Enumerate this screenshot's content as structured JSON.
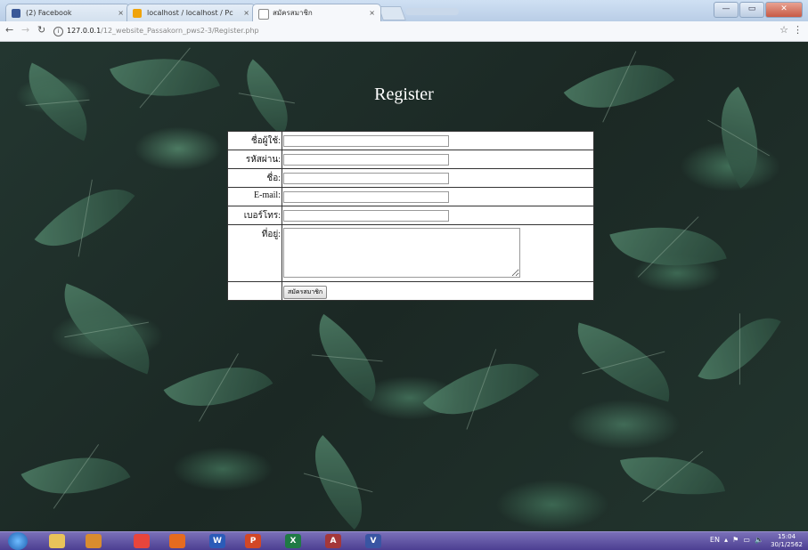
{
  "browser": {
    "tabs": [
      {
        "label": "(2) Facebook",
        "icon": "facebook-icon",
        "color": "#3b5998"
      },
      {
        "label": "localhost / localhost / Pc",
        "icon": "phpmyadmin-icon",
        "color": "#f0a30a"
      },
      {
        "label": "สมัครสมาชิก",
        "icon": "page-icon",
        "color": "#ffffff"
      }
    ],
    "tab_close": "×",
    "window_buttons": {
      "minimize": "—",
      "maximize": "▭",
      "close": "✕"
    },
    "address": {
      "host": "127.0.0.1",
      "path": "/12_website_Passakorn_pws2-3/Register.php"
    }
  },
  "page": {
    "title": "Register",
    "form": {
      "fields": [
        {
          "label": "ชื่อผู้ใช้:",
          "value": ""
        },
        {
          "label": "รหัสผ่าน:",
          "value": ""
        },
        {
          "label": "ชื่อ:",
          "value": ""
        },
        {
          "label": "E-mail:",
          "value": ""
        },
        {
          "label": "เบอร์โทร:",
          "value": ""
        }
      ],
      "address_label": "ที่อยู่:",
      "address_value": "",
      "submit_label": "สมัครสมาชิก"
    }
  },
  "taskbar": {
    "apps": [
      {
        "name": "explorer",
        "glyph": "",
        "color": "#e8c35a"
      },
      {
        "name": "media",
        "glyph": "",
        "color": "#d98c2f"
      },
      {
        "name": "chrome",
        "glyph": "",
        "color": "#e8453c"
      },
      {
        "name": "firefox",
        "glyph": "",
        "color": "#e66b1f"
      },
      {
        "name": "word",
        "glyph": "W",
        "color": "#2b5bb8"
      },
      {
        "name": "powerpoint",
        "glyph": "P",
        "color": "#d24726"
      },
      {
        "name": "excel",
        "glyph": "X",
        "color": "#1f7a45"
      },
      {
        "name": "access",
        "glyph": "A",
        "color": "#a4373a"
      },
      {
        "name": "visio",
        "glyph": "V",
        "color": "#3955a3"
      }
    ],
    "language": "EN",
    "time": "15:04",
    "date": "30/1/2562"
  }
}
